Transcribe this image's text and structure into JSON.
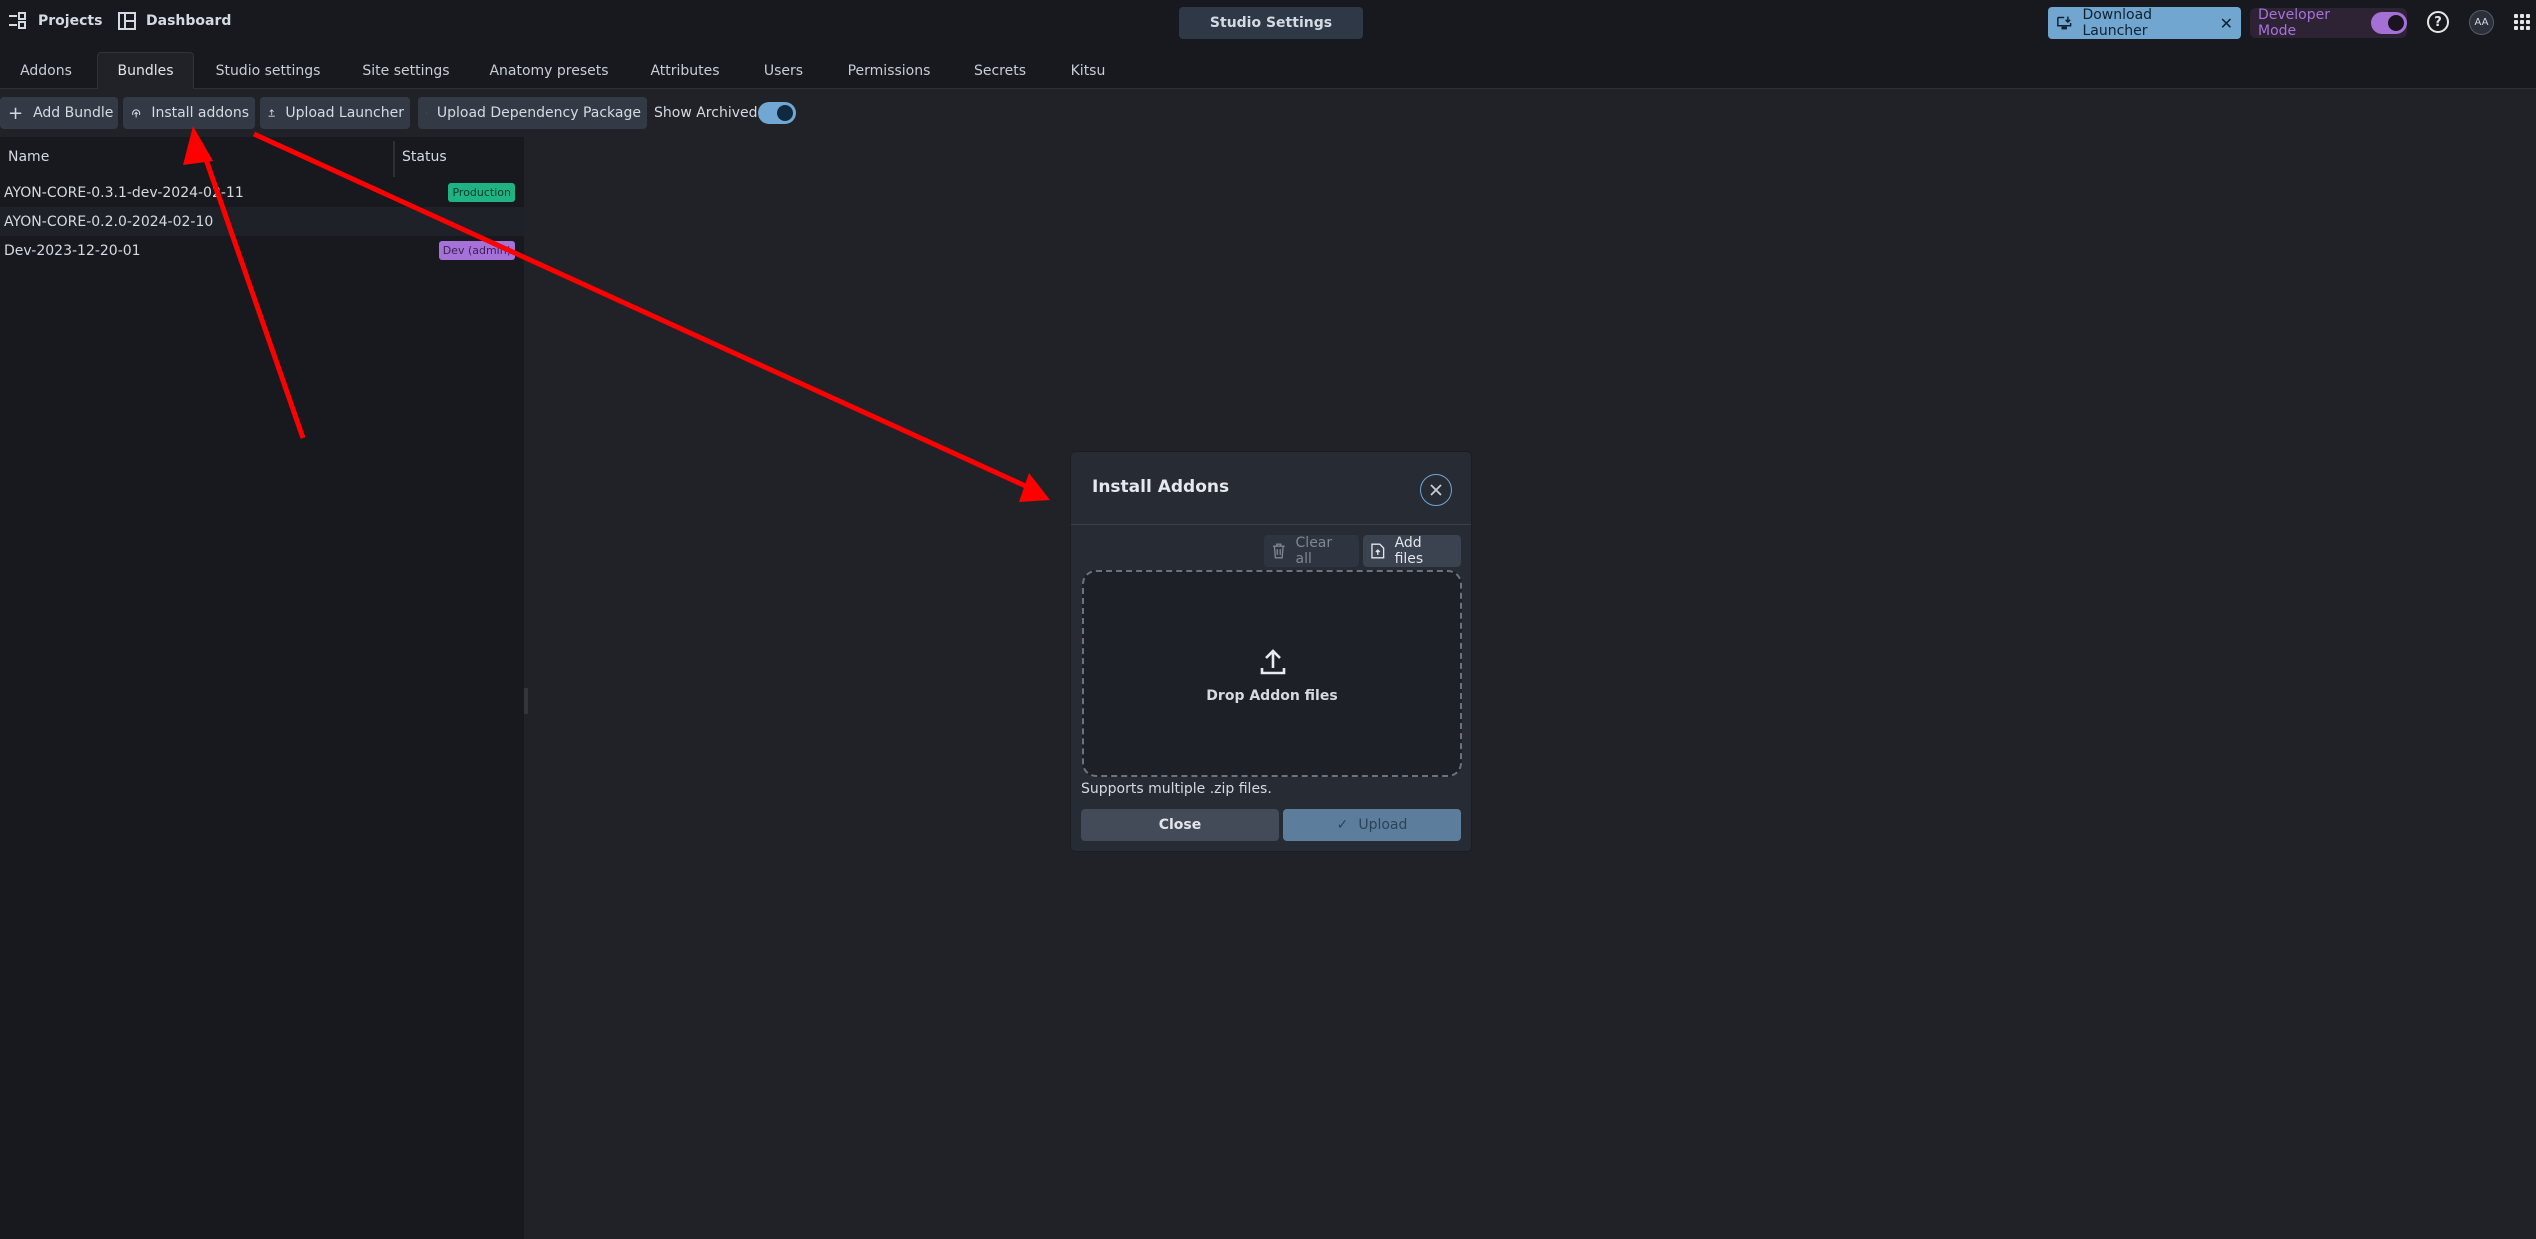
{
  "header": {
    "projects_label": "Projects",
    "dashboard_label": "Dashboard",
    "center_title": "Studio Settings",
    "download_launcher_label": "Download Launcher",
    "developer_mode_label": "Developer Mode",
    "developer_mode_on": true,
    "help_icon": "?",
    "avatar_initials": "AA"
  },
  "tabs": [
    {
      "label": "Addons",
      "active": false
    },
    {
      "label": "Bundles",
      "active": true
    },
    {
      "label": "Studio settings",
      "active": false
    },
    {
      "label": "Site settings",
      "active": false
    },
    {
      "label": "Anatomy presets",
      "active": false
    },
    {
      "label": "Attributes",
      "active": false
    },
    {
      "label": "Users",
      "active": false
    },
    {
      "label": "Permissions",
      "active": false
    },
    {
      "label": "Secrets",
      "active": false
    },
    {
      "label": "Kitsu",
      "active": false
    }
  ],
  "toolbar": {
    "add_bundle": "Add Bundle",
    "install_addons": "Install addons",
    "upload_launcher": "Upload Launcher",
    "upload_dependency": "Upload Dependency Package",
    "show_archived_label": "Show Archived",
    "show_archived_on": true
  },
  "bundles": {
    "columns": {
      "name": "Name",
      "status": "Status"
    },
    "rows": [
      {
        "name": "AYON-CORE-0.3.1-dev-2024-02-11",
        "status": "Production"
      },
      {
        "name": "AYON-CORE-0.2.0-2024-02-10",
        "status": ""
      },
      {
        "name": "Dev-2023-12-20-01",
        "status": "Dev (admin)"
      }
    ]
  },
  "modal": {
    "title": "Install Addons",
    "clear_all": "Clear all",
    "add_files": "Add files",
    "drop_text": "Drop Addon files",
    "support_text": "Supports multiple .zip files.",
    "close": "Close",
    "upload": "Upload"
  },
  "colors": {
    "accent_blue": "#70a6d0",
    "developer_purple": "#a470d6",
    "production_green": "#1fb383",
    "annotation_red": "#ff0000"
  }
}
